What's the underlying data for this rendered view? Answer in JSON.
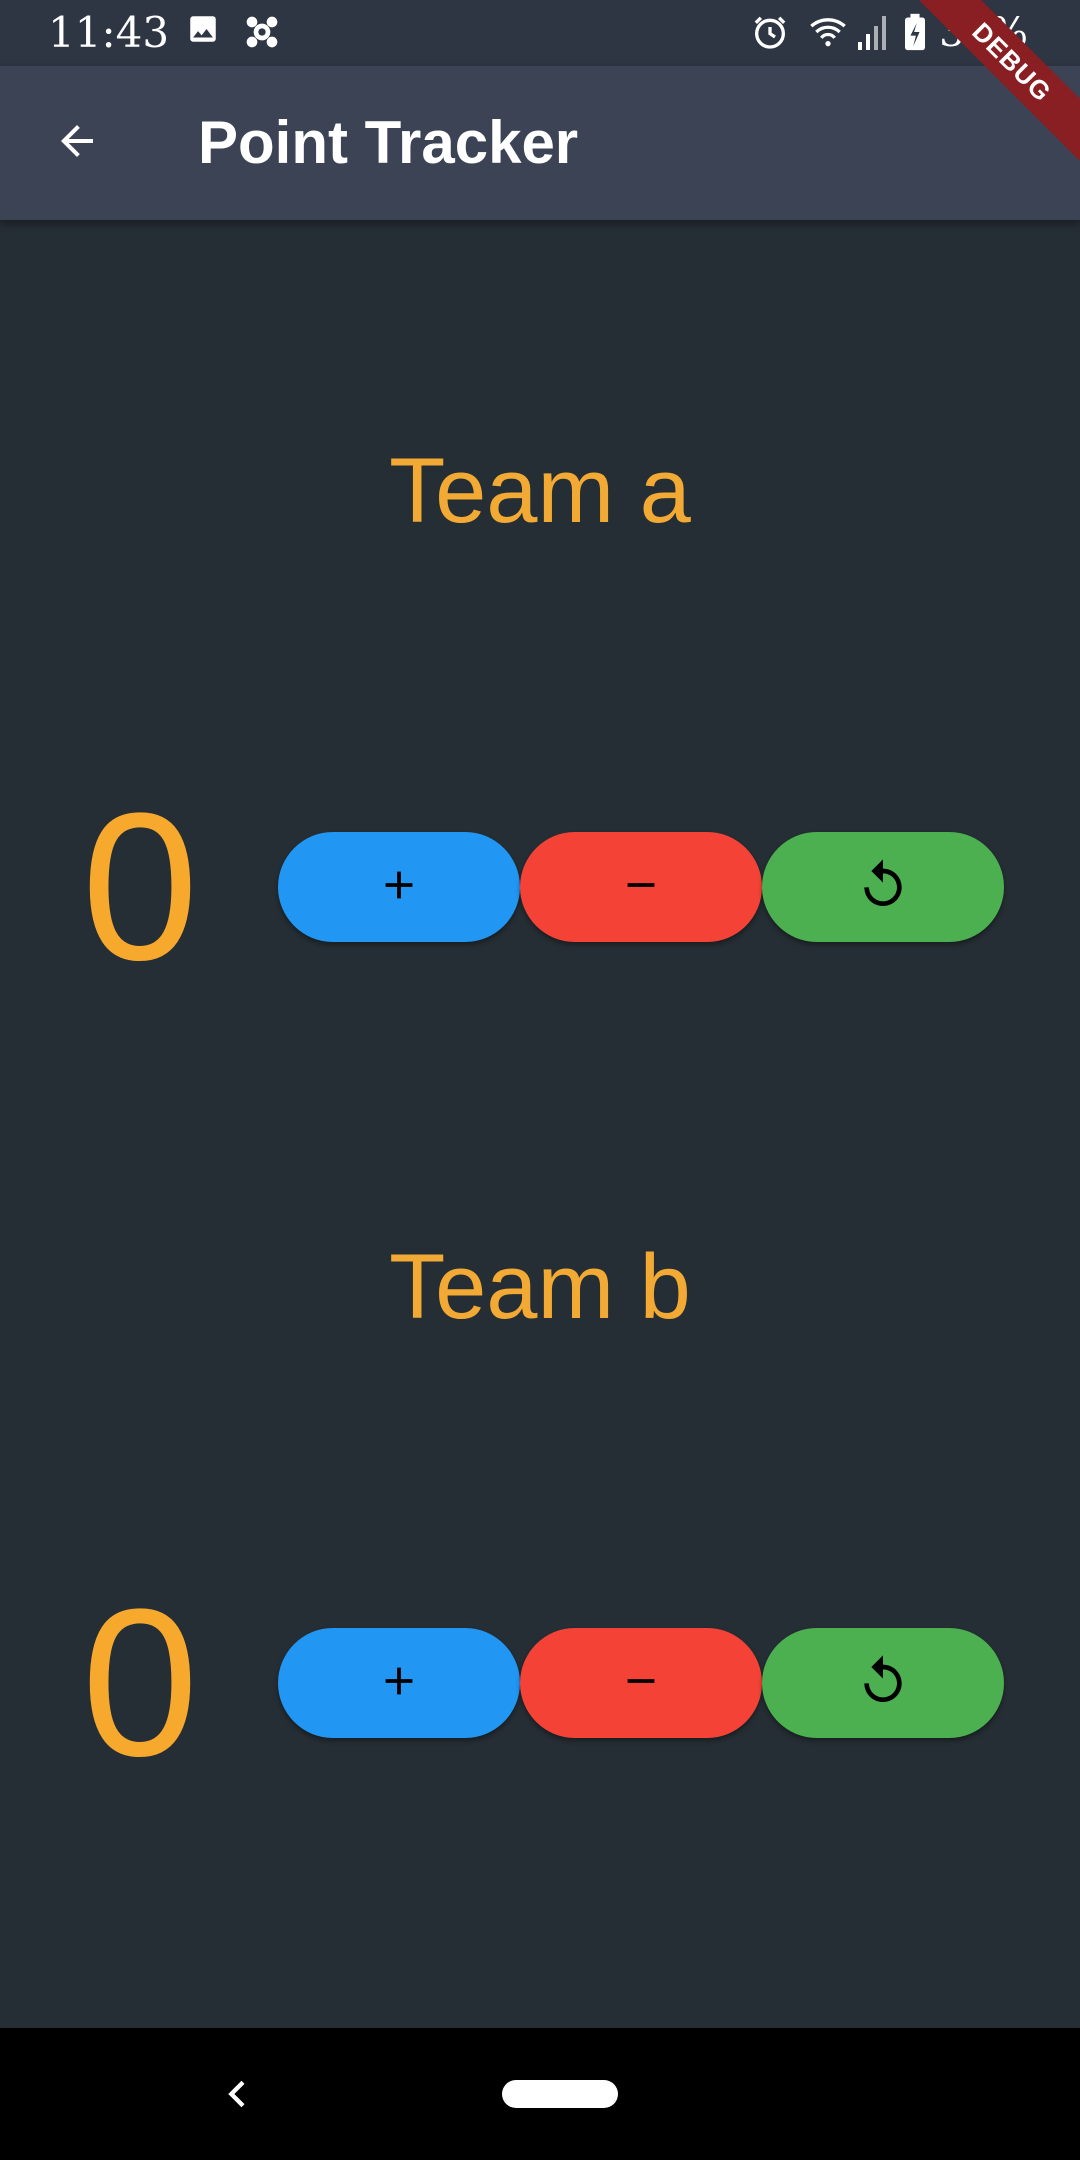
{
  "status_bar": {
    "time": "11:43",
    "battery": "37%",
    "icons": [
      "image-icon",
      "app-notification-icon",
      "alarm-icon",
      "wifi-icon",
      "signal-icon",
      "battery-charging-icon"
    ]
  },
  "app_bar": {
    "title": "Point Tracker",
    "back_icon": "arrow-back-icon"
  },
  "debug_banner": "DEBUG",
  "teams": [
    {
      "name": "Team a",
      "score": "0"
    },
    {
      "name": "Team b",
      "score": "0"
    }
  ],
  "buttons": {
    "add_icon": "plus-icon",
    "subtract_icon": "minus-icon",
    "reset_icon": "replay-icon"
  },
  "colors": {
    "background": "#252e34",
    "app_bar": "#3b4355",
    "accent_text": "#f2aa35",
    "add": "#2196f3",
    "subtract": "#f44336",
    "reset": "#4caf50"
  }
}
